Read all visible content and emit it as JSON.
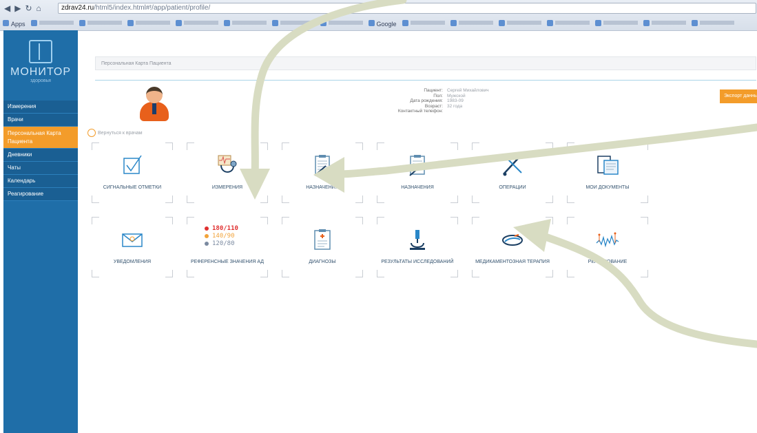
{
  "browser": {
    "url_host": "zdrav24.ru",
    "url_path": "/html5/index.html#!/app/patient/profile/",
    "bookmarks": [
      "Apps",
      "",
      "",
      "",
      "",
      "",
      "",
      "",
      "Google",
      "",
      "",
      "",
      "",
      "",
      "",
      ""
    ]
  },
  "app": {
    "logo_title": "МОНИТОР",
    "logo_subtitle": "здоровья"
  },
  "sidebar": {
    "items": [
      {
        "label": "Измерения"
      },
      {
        "label": "Врачи"
      },
      {
        "label": "Персональная Карта Пациента"
      },
      {
        "label": "Дневники"
      },
      {
        "label": "Чаты"
      },
      {
        "label": "Календарь"
      },
      {
        "label": "Реагирование"
      }
    ]
  },
  "breadcrumb": "Персональная Карта Пациента",
  "back_link": "Вернуться к врачам",
  "patient": {
    "rows": [
      {
        "label": "Пациент:",
        "value": "Сергей Михайлович"
      },
      {
        "label": "Пол:",
        "value": "Мужской"
      },
      {
        "label": "Дата рождения:",
        "value": "1983-09"
      },
      {
        "label": "Возраст:",
        "value": "32 года"
      },
      {
        "label": "Контактный телефон:",
        "value": ""
      }
    ]
  },
  "export_button": "Экспорт данных",
  "tiles": [
    {
      "label": "СИГНАЛЬНЫЕ ОТМЕТКИ",
      "icon": "checkbox-icon"
    },
    {
      "label": "ИЗМЕРЕНИЯ",
      "icon": "stethoscope-icon"
    },
    {
      "label": "НАЗНАЧЕНИЯ",
      "icon": "clipboard-pen-icon"
    },
    {
      "label": "НАЗНАЧЕНИЯ",
      "icon": "clipboard-pen-icon"
    },
    {
      "label": "ОПЕРАЦИИ",
      "icon": "scissors-icon"
    },
    {
      "label": "МОИ ДОКУМЕНТЫ",
      "icon": "documents-icon"
    },
    {
      "label": "УВЕДОМЛЕНИЯ",
      "icon": "envelope-icon"
    },
    {
      "label": "РЕФЕРЕНСНЫЕ ЗНАЧЕНИЯ АД",
      "icon": "blood-pressure-values"
    },
    {
      "label": "ДИАГНОЗЫ",
      "icon": "medical-clipboard-icon"
    },
    {
      "label": "РЕЗУЛЬТАТЫ ИССЛЕДОВАНИЙ",
      "icon": "microscope-icon"
    },
    {
      "label": "МЕДИКАМЕНТОЗНАЯ ТЕРАПИЯ",
      "icon": "pill-icon"
    },
    {
      "label": "РЕАГИРОВАНИЕ",
      "icon": "chart-line-icon"
    }
  ],
  "bp_values": {
    "high": "180/110",
    "mid": "140/90",
    "normal": "120/80"
  },
  "colors": {
    "sidebar": "#1f6ea8",
    "accent": "#f39c2a",
    "arrow": "#d8dcc2"
  }
}
